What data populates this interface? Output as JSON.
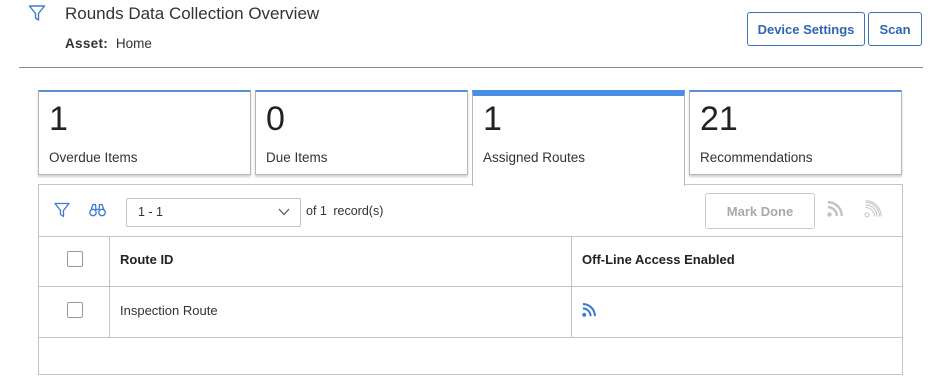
{
  "header": {
    "title": "Rounds Data Collection Overview",
    "asset_label": "Asset:",
    "asset_value": "Home",
    "device_settings_label": "Device Settings",
    "scan_label": "Scan"
  },
  "tiles": [
    {
      "count": "1",
      "label": "Overdue Items",
      "active": false
    },
    {
      "count": "0",
      "label": "Due Items",
      "active": false
    },
    {
      "count": "1",
      "label": "Assigned Routes",
      "active": true
    },
    {
      "count": "21",
      "label": "Recommendations",
      "active": false
    }
  ],
  "toolbar": {
    "pager_value": "1 - 1",
    "records_count": "1",
    "of_label": "of",
    "records_label": "record(s)",
    "mark_done_label": "Mark Done"
  },
  "table": {
    "columns": [
      "Route ID",
      "Off-Line Access Enabled"
    ],
    "rows": [
      {
        "route_id": "Inspection Route",
        "offline_enabled": true
      }
    ]
  },
  "colors": {
    "accent": "#3b73b9",
    "active_tab": "#4a8ee6",
    "rss_icon": "#3f7ad0",
    "disabled": "#a9a9a9"
  }
}
